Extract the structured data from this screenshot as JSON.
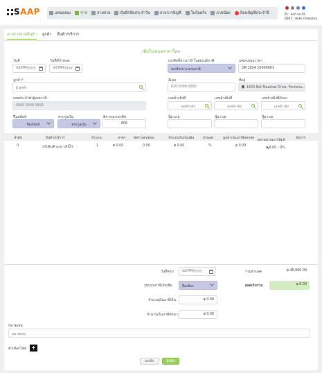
{
  "app": {
    "logo_prefix": "S",
    "logo_suffix": "AAP"
  },
  "menu": [
    {
      "label": "แทนออเม",
      "active": false
    },
    {
      "label": "ขาย",
      "active": true
    },
    {
      "label": "ลายจ่าย",
      "active": false
    },
    {
      "label": "บันทึกปัยประจำวัน",
      "active": false
    },
    {
      "label": "ลายการบัญชี",
      "active": false
    },
    {
      "label": "ใบกุ้มตร้ง",
      "active": false
    },
    {
      "label": "ภาษน้อย",
      "active": false
    },
    {
      "label": "ป้อนบัญชีประจำปี",
      "active": false
    }
  ],
  "user": {
    "id_line": "ID : anh no 01",
    "company_line": "0001 : Auto Company"
  },
  "tabs": [
    {
      "label": "ลายการอวดสินค้า",
      "active": true
    },
    {
      "label": "ลูกค้า",
      "active": false
    },
    {
      "label": "สินค้า/บริการ",
      "active": false
    }
  ],
  "form": {
    "title": "เพิ่มใบเสนอราคาใหม่",
    "date": {
      "label": "วันที่",
      "placeholder": "dd/MM/yyyy"
    },
    "due_date": {
      "label": "วันที่ที่กำหนด",
      "placeholder": "dd/MM/yyyy"
    },
    "doc_type": {
      "label": "เอกสิทธิ์ทางภาษี ในสมเนย์ภาษี",
      "value": "เลกสิทเทาะเดรมสาฝุ้"
    },
    "doc_no": {
      "label": "เลขกเสนอราคา",
      "value": "OR 2024 10000001"
    },
    "customer": {
      "label": "ลูกค้า",
      "required": "*",
      "placeholder": "ผู้ ลูกค้า"
    },
    "email": {
      "label": "อีเมล",
      "value": "020 0000 0000"
    },
    "address": {
      "label": "ที่อยู่",
      "value": "1833 Bat Meadow Drive, Fontana..."
    },
    "tax_id": {
      "label": "เลขประจำตัวผู้เสยภาษี",
      "value": "0000 0000 0000"
    },
    "ref1": {
      "label": "เลขอ้างอิงที่",
      "placeholder": "เลขอ้างอิง"
    },
    "ref2": {
      "label": "เลขอ้างอิงที่",
      "placeholder": "เลขอ้างอิง"
    },
    "ref3": {
      "label": "เลขอ้างอิงที่ถัดมา",
      "placeholder": "เลขอ้างอิง"
    },
    "currency": {
      "label": "ปืนสนัยห์",
      "value": "ปืนสนัยห์"
    },
    "price_type": {
      "label": "ตระกูลเงิน",
      "value": "ตระกูลเงิน"
    },
    "credit": {
      "label": "พิจารณาเครดิต",
      "value": "600"
    },
    "extra1": {
      "label": "ปุ้มาะเย"
    },
    "extra2": {
      "label": "ปุ้มาะเย"
    },
    "extra3": {
      "label": "ปุ้มาะเย"
    }
  },
  "table": {
    "headers": [
      "ลำดับ",
      "สินค้า/บริการ",
      "จำนวน",
      "ลาคา",
      "อัตราลดหย่อน",
      "จำนวนเงินก่อนพิม",
      "ส่วนลด",
      "มูลค่าก่อนภาษีหลจลด",
      "ตลาดมาณการพิมพ์",
      "จัดการ"
    ],
    "row": {
      "index": "0",
      "product": "ปรับสินค้าและ บริการ",
      "qty": "1",
      "price": "฿ 0.00",
      "discount_rate": "0.00",
      "amount": "฿ 0.00",
      "discount": "%",
      "net": "฿ 0.00",
      "tax": "฿ 0.00 - 0%"
    }
  },
  "summary": {
    "valid_date": {
      "label": "วันที่ครบ",
      "placeholder": "dd/MM/yyyy"
    },
    "total_discount": {
      "label": "รวมส่วนลด",
      "value": "฿ 40,000.00"
    },
    "vat_type": {
      "label": "รูปแบบภาษีเงินเพิ่ม",
      "value": "ปืนเลือก"
    },
    "grand_total": {
      "label": "ยอดเงินรวม",
      "value": "฿ 0.00"
    },
    "vat_amount": {
      "label": "จำนวนเงินภาษีเงิน",
      "value": "฿ 0.00"
    },
    "withholding": {
      "label": "จำนวนเงินภาษีหักมา",
      "value": "฿ 0.00"
    }
  },
  "notes": {
    "label": "หมายเหตุ",
    "placeholder": "หมายเหตุ"
  },
  "attachments": {
    "label": "ตัวเลือกไฟล์"
  },
  "buttons": {
    "cancel": "ยกเลิก",
    "save": "บันทึก"
  }
}
